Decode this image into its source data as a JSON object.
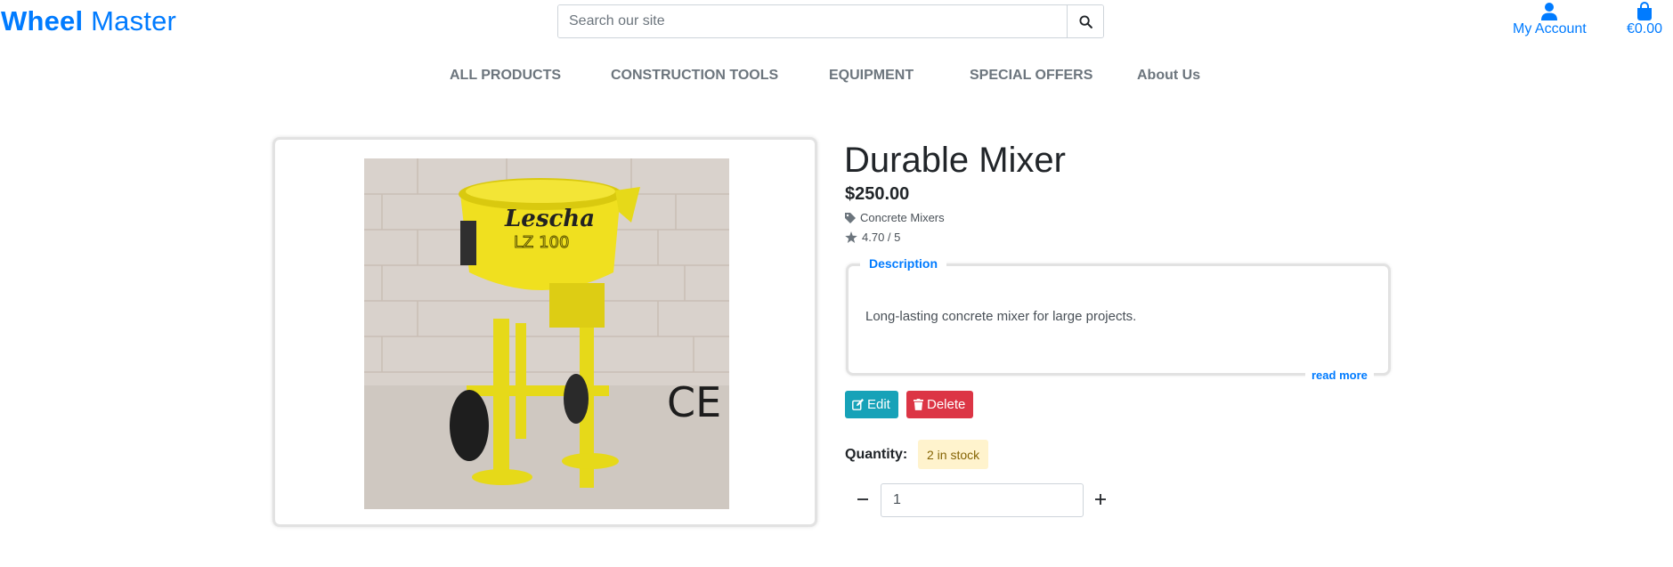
{
  "header": {
    "brand_part1": "Wheel",
    "brand_part2": "Master",
    "search_placeholder": "Search our site",
    "account_label": "My Account",
    "cart_total": "€0.00"
  },
  "nav": {
    "items": [
      "ALL PRODUCTS",
      "CONSTRUCTION TOOLS",
      "EQUIPMENT",
      "SPECIAL OFFERS",
      "About Us"
    ]
  },
  "product": {
    "title": "Durable Mixer",
    "price": "$250.00",
    "category": "Concrete Mixers",
    "rating": "4.70 / 5",
    "image_brand": "Lescha",
    "image_model": "LZ 100",
    "image_mark": "CE",
    "description_legend": "Description",
    "description": "Long-lasting concrete mixer for large projects.",
    "read_more": "read more",
    "edit_label": "Edit",
    "delete_label": "Delete",
    "quantity_label": "Quantity:",
    "stock": "2 in stock",
    "quantity_value": "1"
  },
  "colors": {
    "primary": "#007bff",
    "info": "#17a2b8",
    "danger": "#dc3545",
    "warning_bg": "#fff3cd",
    "nav_text": "#6c757d"
  },
  "icons": [
    "search-icon",
    "user-icon",
    "shopping-bag-icon",
    "tag-icon",
    "star-icon",
    "edit-icon",
    "trash-icon",
    "minus-icon",
    "plus-icon"
  ]
}
